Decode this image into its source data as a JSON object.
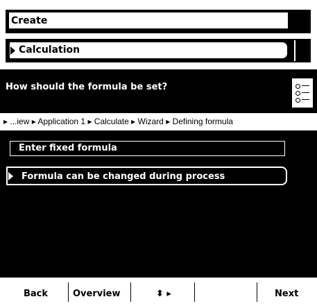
{
  "menu": {
    "create_label": "Create",
    "calculation_label": "Calculation"
  },
  "question": "How should the formula be set?",
  "breadcrumb": "▸ ...iew ▸ Application 1 ▸ Calculate ▸ Wizard ▸ Defining formula",
  "options": [
    {
      "label": "Enter fixed formula",
      "selected": false
    },
    {
      "label": "Formula can be changed during process",
      "selected": true
    }
  ],
  "softkeys": {
    "back": "Back",
    "overview": "Overview",
    "navigate": "⬍ ▸",
    "next": "Next"
  }
}
